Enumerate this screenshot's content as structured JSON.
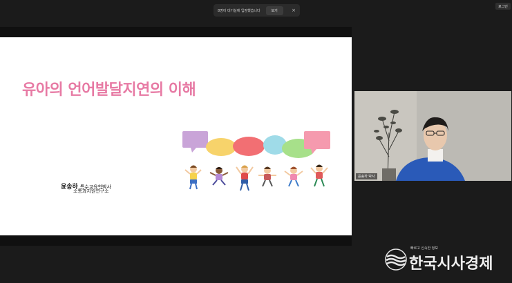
{
  "notice": {
    "text": "8명이 대기실에 입장했습니다",
    "view_label": "보기",
    "close_glyph": "×"
  },
  "topbar": {
    "login_label": "로그인"
  },
  "slide": {
    "title": "유아의 언어발달지연의 이해",
    "presenter_name": "윤송하",
    "presenter_degree": "특수교육학박사",
    "affiliation": "소통과지원연구소",
    "title_color": "#e77aa4"
  },
  "webcam": {
    "label": "윤송하 박사"
  },
  "watermark": {
    "tagline": "빠르고 신속한 정보",
    "brand": "한국시사경제"
  }
}
